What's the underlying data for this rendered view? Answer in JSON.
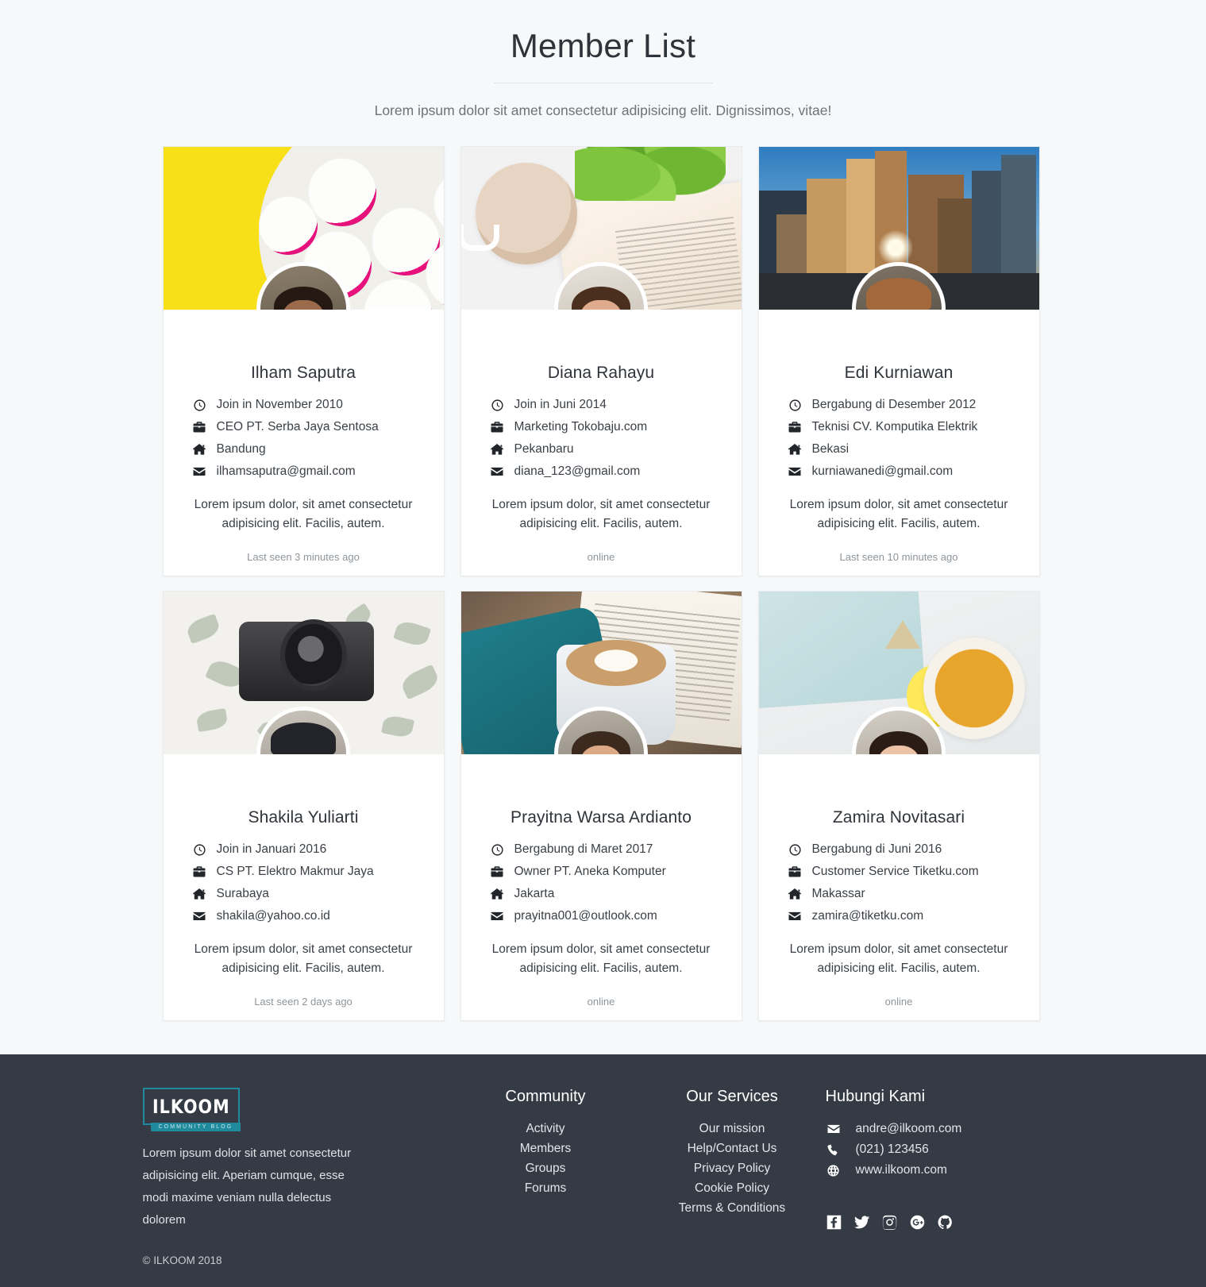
{
  "header": {
    "title": "Member List",
    "subtitle": "Lorem ipsum dolor sit amet consectetur adipisicing elit. Dignissimos, vitae!"
  },
  "members": [
    {
      "name": "Ilham Saputra",
      "joined": "Join in November 2010",
      "job": "CEO PT. Serba Jaya Sentosa",
      "city": "Bandung",
      "email": "ilhamsaputra@gmail.com",
      "bio": "Lorem ipsum dolor, sit amet consectetur adipisicing elit. Facilis, autem.",
      "status": "Last seen 3 minutes ago"
    },
    {
      "name": "Diana Rahayu",
      "joined": "Join in Juni 2014",
      "job": "Marketing Tokobaju.com",
      "city": "Pekanbaru",
      "email": "diana_123@gmail.com",
      "bio": "Lorem ipsum dolor, sit amet consectetur adipisicing elit. Facilis, autem.",
      "status": "online"
    },
    {
      "name": "Edi Kurniawan",
      "joined": "Bergabung di Desember 2012",
      "job": "Teknisi CV. Komputika Elektrik",
      "city": "Bekasi",
      "email": "kurniawanedi@gmail.com",
      "bio": "Lorem ipsum dolor, sit amet consectetur adipisicing elit. Facilis, autem.",
      "status": "Last seen 10 minutes ago"
    },
    {
      "name": "Shakila Yuliarti",
      "joined": "Join in Januari 2016",
      "job": "CS PT. Elektro Makmur Jaya",
      "city": "Surabaya",
      "email": "shakila@yahoo.co.id",
      "bio": "Lorem ipsum dolor, sit amet consectetur adipisicing elit. Facilis, autem.",
      "status": "Last seen 2 days ago"
    },
    {
      "name": "Prayitna Warsa Ardianto",
      "joined": "Bergabung di Maret 2017",
      "job": "Owner PT. Aneka Komputer",
      "city": "Jakarta",
      "email": "prayitna001@outlook.com",
      "bio": "Lorem ipsum dolor, sit amet consectetur adipisicing elit. Facilis, autem.",
      "status": "online"
    },
    {
      "name": "Zamira Novitasari",
      "joined": "Bergabung di Juni 2016",
      "job": "Customer Service Tiketku.com",
      "city": "Makassar",
      "email": "zamira@tiketku.com",
      "bio": "Lorem ipsum dolor, sit amet consectetur adipisicing elit. Facilis, autem.",
      "status": "online"
    }
  ],
  "meta_icons": {
    "joined": "clock-icon",
    "job": "briefcase-icon",
    "city": "home-icon",
    "email": "envelope-icon"
  },
  "footer": {
    "logo_text": "ILKOOM",
    "logo_tagline": "COMMUNITY BLOG",
    "about": "Lorem ipsum dolor sit amet consectetur adipisicing elit. Aperiam cumque, esse modi maxime veniam nulla delectus dolorem",
    "copyright": "© ILKOOM 2018",
    "columns": [
      {
        "title": "Community",
        "links": [
          "Activity",
          "Members",
          "Groups",
          "Forums"
        ]
      },
      {
        "title": "Our Services",
        "links": [
          "Our mission",
          "Help/Contact Us",
          "Privacy Policy",
          "Cookie Policy",
          "Terms & Conditions"
        ]
      }
    ],
    "contact": {
      "title": "Hubungi Kami",
      "items": [
        {
          "icon": "envelope-icon",
          "value": "andre@ilkoom.com"
        },
        {
          "icon": "phone-icon",
          "value": "(021) 123456"
        },
        {
          "icon": "globe-icon",
          "value": "www.ilkoom.com"
        }
      ]
    },
    "social": [
      "facebook-icon",
      "twitter-icon",
      "instagram-icon",
      "google-plus-icon",
      "github-icon"
    ]
  },
  "colors": {
    "page_background": "#f6f8f9",
    "card_background": "#ffffff",
    "footer_background": "#353b45",
    "accent_teal": "#1f8a9c",
    "text_primary": "#2f343a",
    "text_muted": "#8e959b"
  }
}
